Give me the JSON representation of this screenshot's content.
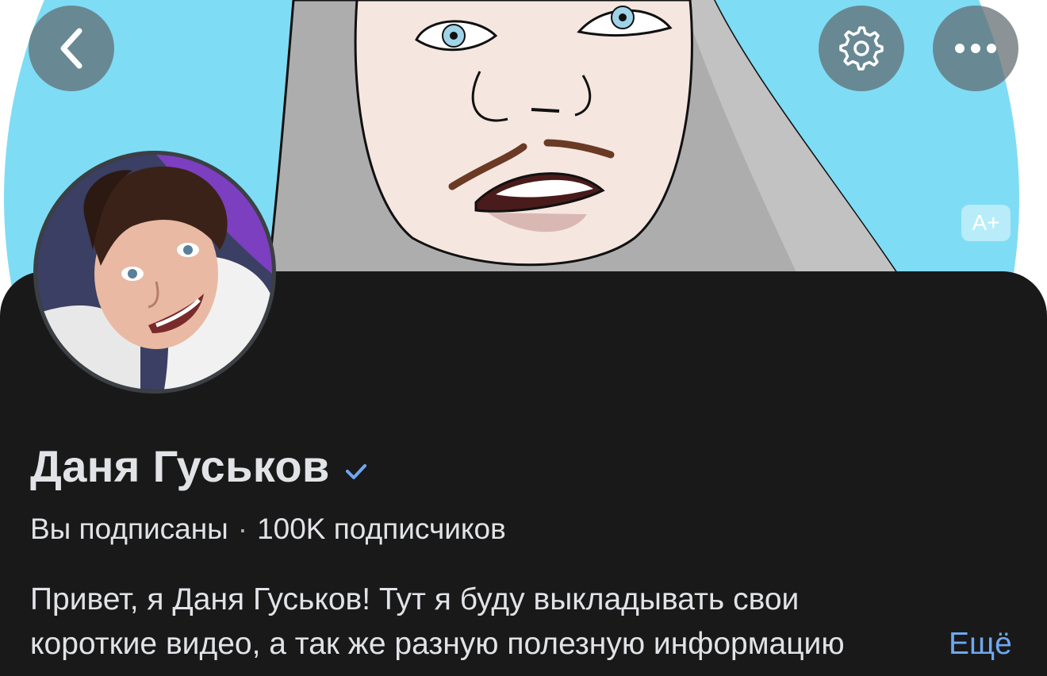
{
  "header": {
    "back_icon": "chevron-left-icon",
    "settings_icon": "gear-icon",
    "more_icon": "ellipsis-icon",
    "font_size_badge": "A+"
  },
  "profile": {
    "name": "Даня Гуськов",
    "verified": true,
    "subscription_status": "Вы подписаны",
    "separator": "·",
    "subscribers": "100K подписчиков",
    "bio_line1": "Привет, я Даня Гуськов! Тут я буду выкладывать свои",
    "bio_line2": "короткие видео, а так же разную полезную информацию",
    "more_label": "Ещё"
  },
  "colors": {
    "sheet_background": "#19191a",
    "cover_background": "#7fdcf5",
    "text_primary": "#e1e3e6",
    "link": "#6fa8f0",
    "verified_badge": "#6fa8f0"
  }
}
